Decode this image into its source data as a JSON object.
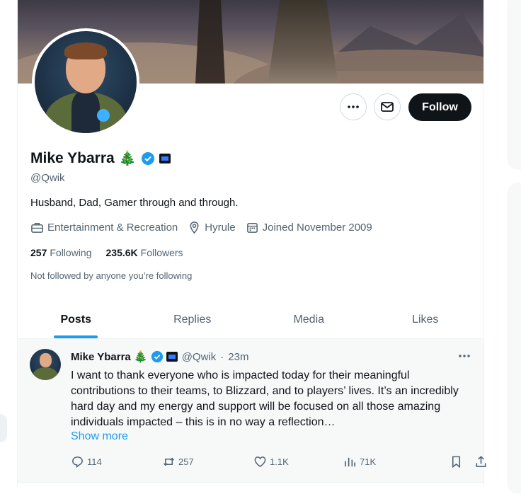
{
  "profile": {
    "display_name": "Mike Ybarra",
    "name_emoji": "🎄",
    "handle": "@Qwik",
    "bio": "Husband, Dad, Gamer through and through.",
    "category": "Entertainment & Recreation",
    "location": "Hyrule",
    "joined": "Joined November 2009",
    "following_count": "257",
    "following_label": "Following",
    "followers_count": "235.6K",
    "followers_label": "Followers",
    "followed_note": "Not followed by anyone you’re following"
  },
  "buttons": {
    "follow_label": "Follow",
    "more_icon": "ellipsis-icon",
    "message_icon": "envelope-icon"
  },
  "tabs": [
    {
      "label": "Posts",
      "active": true
    },
    {
      "label": "Replies",
      "active": false
    },
    {
      "label": "Media",
      "active": false
    },
    {
      "label": "Likes",
      "active": false
    }
  ],
  "post": {
    "author": "Mike Ybarra",
    "author_emoji": "🎄",
    "handle": "@Qwik",
    "separator": "·",
    "time": "23m",
    "text": "I want to thank everyone who is impacted today for their meaningful contributions to their teams, to Blizzard, and to players’ lives. It’s an incredibly hard day and my energy and support will be focused on all those amazing individuals impacted – this is in no way a reflection…",
    "show_more": "Show more",
    "replies": "114",
    "reposts": "257",
    "likes": "1.1K",
    "views": "71K"
  },
  "colors": {
    "accent": "#1d9bf0",
    "text_primary": "#0f1419",
    "text_secondary": "#536471",
    "follow_bg": "#0f1419",
    "border": "#eff3f4"
  }
}
